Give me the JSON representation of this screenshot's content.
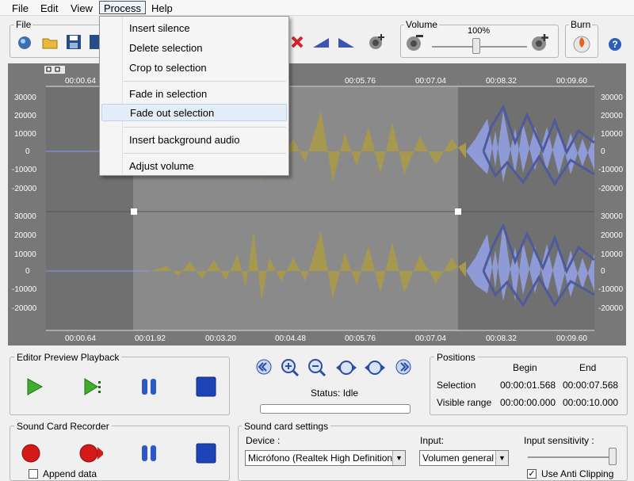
{
  "menubar": {
    "items": [
      {
        "label": "File"
      },
      {
        "label": "Edit"
      },
      {
        "label": "View"
      },
      {
        "label": "Process"
      },
      {
        "label": "Help"
      }
    ]
  },
  "toolbar": {
    "file_group_label": "File",
    "volume_group_label": "Volume",
    "volume_percent": "100%",
    "volume_level": 1.0,
    "burn_label": "Burn"
  },
  "process_menu": {
    "items": [
      {
        "label": "Insert silence"
      },
      {
        "label": "Delete selection"
      },
      {
        "label": "Crop to selection"
      },
      {
        "label": "Fade in selection"
      },
      {
        "label": "Fade out selection"
      },
      {
        "label": "Insert background audio"
      },
      {
        "label": "Adjust volume"
      }
    ]
  },
  "waveform": {
    "top_ruler": [
      "00:00.64",
      "00:05.76",
      "00:07.04",
      "00:08.32",
      "00:09.60"
    ],
    "bottom_ruler": [
      "00:00.64",
      "00:01.92",
      "00:03.20",
      "00:04.48",
      "00:05.76",
      "00:07.04",
      "00:08.32",
      "00:09.60"
    ],
    "y_labels": [
      "30000",
      "20000",
      "10000",
      "0",
      "-10000",
      "-20000"
    ],
    "colors": {
      "background": "#787878",
      "selection": "#8a8a8a",
      "olive_wave": "#a6984f",
      "blue_wave": "#8f9bd6",
      "dark_blue": "#4f5a9c"
    }
  },
  "editor_preview": {
    "title": "Editor Preview Playback"
  },
  "zoom": {
    "status": "Status: Idle"
  },
  "positions": {
    "title": "Positions",
    "begin_header": "Begin",
    "end_header": "End",
    "selection_label": "Selection",
    "selection_begin": "00:00:01.568",
    "selection_end": "00:00:07.568",
    "visible_label": "Visible range",
    "visible_begin": "00:00:00.000",
    "visible_end": "00:00:10.000"
  },
  "recorder": {
    "title": "Sound Card Recorder",
    "append_label": "Append data"
  },
  "soundcard": {
    "title": "Sound card settings",
    "device_label": "Device :",
    "device_value": "Micrófono (Realtek High Definition",
    "input_label": "Input:",
    "input_value": "Volumen general",
    "sensitivity_label": "Input sensitivity :",
    "sensitivity_level": 1.0,
    "anticlip_label": "Use Anti Clipping"
  }
}
